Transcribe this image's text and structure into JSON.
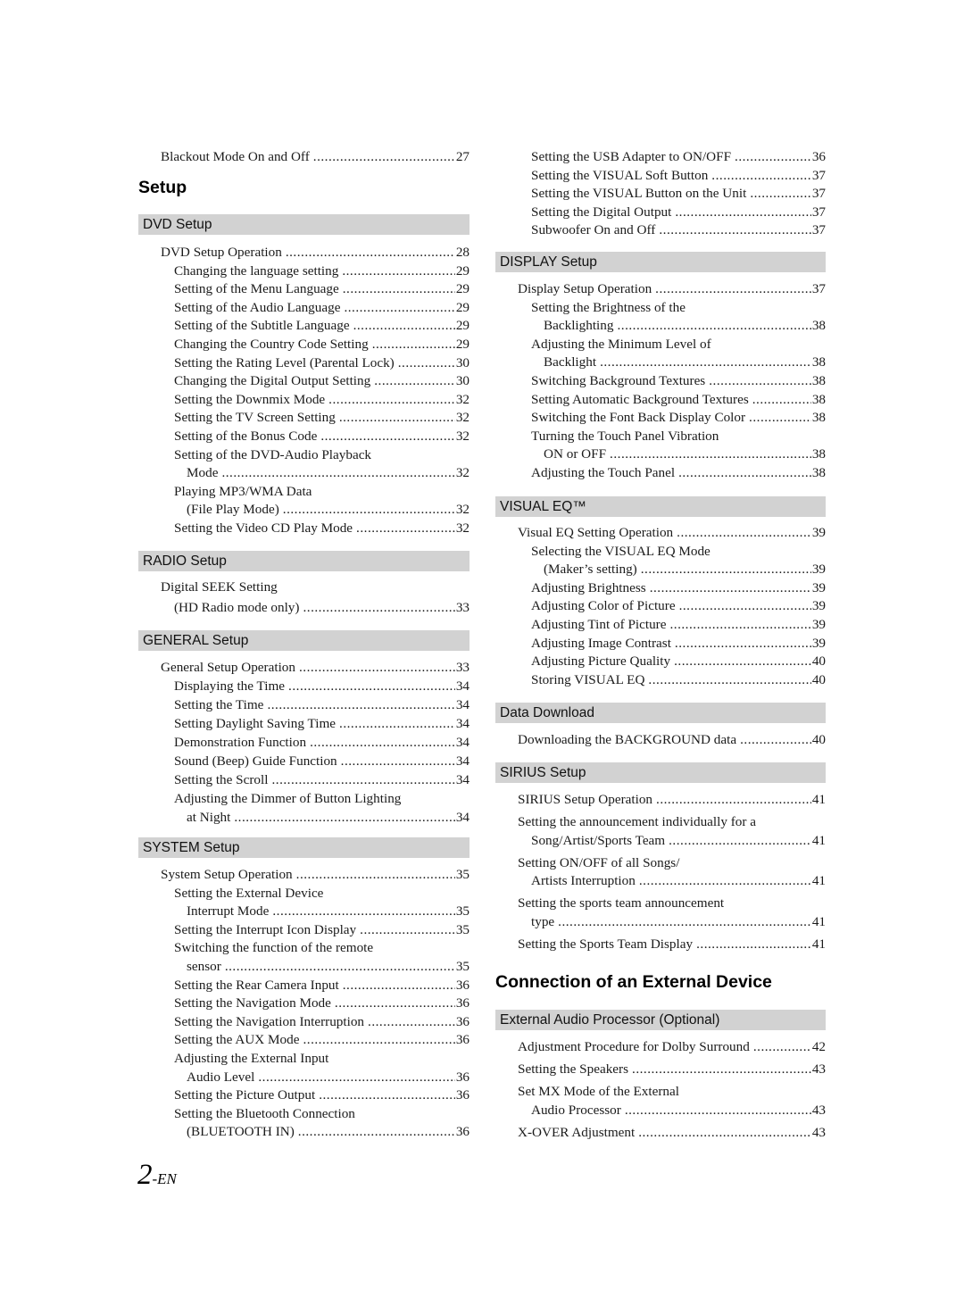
{
  "left": {
    "intro": [
      {
        "label": "Blackout Mode On and Off",
        "page": "27",
        "level": 0
      }
    ],
    "section_title": "Setup",
    "groups": [
      {
        "header": "DVD Setup",
        "entries": [
          {
            "label": "DVD Setup Operation",
            "page": "28",
            "level": 0
          },
          {
            "label": "Changing the language setting",
            "page": "29",
            "level": 1
          },
          {
            "label": "Setting of the Menu Language",
            "page": "29",
            "level": 1
          },
          {
            "label": "Setting of the Audio Language",
            "page": "29",
            "level": 1
          },
          {
            "label": "Setting of the Subtitle Language",
            "page": "29",
            "level": 1
          },
          {
            "label": "Changing the Country Code Setting",
            "page": "29",
            "level": 1
          },
          {
            "label": "Setting the Rating Level (Parental Lock)",
            "page": "30",
            "level": 1
          },
          {
            "label": "Changing the Digital Output Setting",
            "page": "30",
            "level": 1
          },
          {
            "label": "Setting the Downmix Mode",
            "page": "32",
            "level": 1
          },
          {
            "label": "Setting the TV Screen Setting",
            "page": "32",
            "level": 1
          },
          {
            "label": "Setting of the Bonus Code",
            "page": "32",
            "level": 1
          },
          {
            "label": "Setting of the DVD-Audio Playback",
            "page": "",
            "level": 1
          },
          {
            "label": "Mode",
            "page": "32",
            "level": 2
          },
          {
            "label": "Playing MP3/WMA Data",
            "page": "",
            "level": 1
          },
          {
            "label": "(File Play Mode)",
            "page": "32",
            "level": 2
          },
          {
            "label": "Setting the Video CD Play Mode",
            "page": "32",
            "level": 1
          }
        ]
      },
      {
        "header": "RADIO Setup",
        "entries": [
          {
            "label": "Digital SEEK Setting",
            "page": "",
            "level": 0
          },
          {
            "label": "(HD Radio mode only)",
            "page": "33",
            "level": 1
          }
        ]
      },
      {
        "header": "GENERAL Setup",
        "entries": [
          {
            "label": "General Setup Operation",
            "page": "33",
            "level": 0
          },
          {
            "label": "Displaying the Time",
            "page": "34",
            "level": 1
          },
          {
            "label": "Setting the Time",
            "page": "34",
            "level": 1
          },
          {
            "label": "Setting Daylight Saving Time",
            "page": "34",
            "level": 1
          },
          {
            "label": "Demonstration Function",
            "page": "34",
            "level": 1
          },
          {
            "label": "Sound (Beep) Guide Function",
            "page": "34",
            "level": 1
          },
          {
            "label": "Setting the Scroll",
            "page": "34",
            "level": 1
          },
          {
            "label": "Adjusting the Dimmer of Button Lighting",
            "page": "",
            "level": 1
          },
          {
            "label": "at Night",
            "page": "34",
            "level": 2
          }
        ]
      },
      {
        "header": "SYSTEM Setup",
        "entries": [
          {
            "label": "System Setup Operation",
            "page": "35",
            "level": 0
          },
          {
            "label": "Setting the External Device",
            "page": "",
            "level": 1
          },
          {
            "label": "Interrupt Mode",
            "page": "35",
            "level": 2
          },
          {
            "label": "Setting the Interrupt Icon Display",
            "page": "35",
            "level": 1
          },
          {
            "label": "Switching the function of the remote",
            "page": "",
            "level": 1
          },
          {
            "label": "sensor",
            "page": "35",
            "level": 2
          },
          {
            "label": "Setting the Rear Camera Input",
            "page": "36",
            "level": 1
          },
          {
            "label": "Setting the Navigation Mode",
            "page": "36",
            "level": 1
          },
          {
            "label": "Setting the Navigation Interruption",
            "page": "36",
            "level": 1
          },
          {
            "label": "Setting the AUX Mode",
            "page": "36",
            "level": 1
          },
          {
            "label": "Adjusting the External Input",
            "page": "",
            "level": 1
          },
          {
            "label": "Audio Level",
            "page": "36",
            "level": 2
          },
          {
            "label": "Setting the Picture Output",
            "page": "36",
            "level": 1
          },
          {
            "label": "Setting the Bluetooth Connection",
            "page": "",
            "level": 1
          },
          {
            "label": "(BLUETOOTH IN)",
            "page": "36",
            "level": 2
          }
        ]
      }
    ]
  },
  "right": {
    "intro": [
      {
        "label": "Setting the USB Adapter to ON/OFF",
        "page": "36",
        "level": 1
      },
      {
        "label": "Setting the VISUAL Soft Button",
        "page": "37",
        "level": 1
      },
      {
        "label": "Setting the VISUAL Button on the Unit",
        "page": "37",
        "level": 1
      },
      {
        "label": "Setting the Digital Output",
        "page": "37",
        "level": 1
      },
      {
        "label": "Subwoofer On and Off",
        "page": "37",
        "level": 1
      }
    ],
    "groups": [
      {
        "header": "DISPLAY Setup",
        "entries": [
          {
            "label": "Display Setup Operation",
            "page": "37",
            "level": 0
          },
          {
            "label": "Setting the Brightness of the",
            "page": "",
            "level": 1
          },
          {
            "label": "Backlighting",
            "page": "38",
            "level": 2
          },
          {
            "label": "Adjusting the Minimum Level of",
            "page": "",
            "level": 1
          },
          {
            "label": "Backlight",
            "page": "38",
            "level": 2
          },
          {
            "label": "Switching Background Textures",
            "page": "38",
            "level": 1
          },
          {
            "label": "Setting Automatic Background Textures",
            "page": "38",
            "level": 1
          },
          {
            "label": "Switching the Font Back Display Color",
            "page": "38",
            "level": 1
          },
          {
            "label": "Turning the Touch Panel Vibration",
            "page": "",
            "level": 1
          },
          {
            "label": "ON or OFF",
            "page": "38",
            "level": 2
          },
          {
            "label": "Adjusting the Touch Panel",
            "page": "38",
            "level": 1
          }
        ]
      },
      {
        "header": "VISUAL EQ™",
        "entries": [
          {
            "label": "Visual EQ Setting Operation",
            "page": "39",
            "level": 0
          },
          {
            "label": "Selecting the VISUAL EQ Mode",
            "page": "",
            "level": 1
          },
          {
            "label": "(Maker’s setting)",
            "page": "39",
            "level": 2
          },
          {
            "label": "Adjusting Brightness",
            "page": "39",
            "level": 1
          },
          {
            "label": "Adjusting Color of Picture",
            "page": "39",
            "level": 1
          },
          {
            "label": "Adjusting Tint of Picture",
            "page": "39",
            "level": 1
          },
          {
            "label": "Adjusting Image Contrast",
            "page": "39",
            "level": 1
          },
          {
            "label": "Adjusting Picture Quality",
            "page": "40",
            "level": 1
          },
          {
            "label": "Storing VISUAL EQ",
            "page": "40",
            "level": 1
          }
        ]
      },
      {
        "header": "Data Download",
        "entries": [
          {
            "label": "Downloading the BACKGROUND data",
            "page": "40",
            "level": 0
          }
        ]
      },
      {
        "header": "SIRIUS Setup",
        "entries": [
          {
            "label": "SIRIUS Setup Operation",
            "page": "41",
            "level": 0
          },
          {
            "label": "Setting the announcement individually for a",
            "page": "",
            "level": 0
          },
          {
            "label": "Song/Artist/Sports Team",
            "page": "41",
            "level": 1
          },
          {
            "label": "Setting ON/OFF of all Songs/",
            "page": "",
            "level": 0
          },
          {
            "label": "Artists Interruption",
            "page": "41",
            "level": 1
          },
          {
            "label": "Setting the sports team announcement",
            "page": "",
            "level": 0
          },
          {
            "label": "type",
            "page": "41",
            "level": 1
          },
          {
            "label": "Setting the Sports Team Display",
            "page": "41",
            "level": 0
          }
        ]
      }
    ],
    "section2_title": "Connection of an External Device",
    "groups2": [
      {
        "header": "External Audio Processor (Optional)",
        "entries": [
          {
            "label": "Adjustment Procedure for Dolby Surround",
            "page": "42",
            "level": 0
          },
          {
            "label": "Setting the Speakers",
            "page": "43",
            "level": 0
          },
          {
            "label": "Set MX Mode of the External",
            "page": "",
            "level": 0
          },
          {
            "label": "Audio Processor",
            "page": "43",
            "level": 1
          },
          {
            "label": "X-OVER Adjustment",
            "page": "43",
            "level": 0
          }
        ]
      }
    ]
  },
  "footer": {
    "page_number": "2",
    "page_suffix": "-EN"
  }
}
